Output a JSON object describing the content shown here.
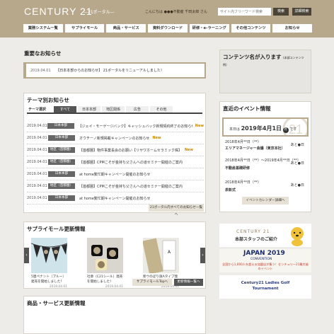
{
  "header": {
    "logo": "CENTURY 21",
    "logo_sub": "—21ポータル—",
    "greeting": "こんにちは ●●●不動産 千田太郎 さん",
    "search_placeholder": "サイト内フリーワード検索",
    "search_button": "検索",
    "advanced_button": "詳細検索"
  },
  "nav": [
    "業務システム一覧",
    "サプライモール",
    "商品・サービス",
    "資料ダウンロード",
    "研修・e-ラーニング",
    "その他コンテンツ",
    "お知らせ"
  ],
  "important": {
    "title": "重要なお知らせ",
    "date": "2019.04.01",
    "text": "【日本本部からのお知らせ】 21ポータルをリニューアルしました！"
  },
  "themed": {
    "title": "テーマ別お知らせ",
    "tab_label": "テーマ選択",
    "tabs": [
      "すべて",
      "日本本部",
      "地区関係",
      "広告",
      "その他"
    ],
    "rows": [
      {
        "date": "2019.04.01",
        "cat": "日本本部",
        "text": "【ジェイ・モーゲージバンク】キャッシュバック新規契約終了のお知らせ",
        "new": "New"
      },
      {
        "date": "2019.04.01",
        "cat": "日本本部",
        "text": "オウチーノ新規掲載キャンペーンのお知らせ",
        "new": "New"
      },
      {
        "date": "2019.04.01",
        "cat": "地区（首都圏）",
        "text": "【首都圏】物件事業長会のお願い【リサワホームセラミック株】",
        "new": "New"
      },
      {
        "date": "2019.04.01",
        "cat": "地区（首都圏）",
        "text": "【首都圏】CPMこそが金持ち父さんへの道セミナー開催のご案内",
        "new": ""
      },
      {
        "date": "2019.04.01",
        "cat": "日本本部",
        "text": "at home繁忙期キャンペーン開催のお知らせ",
        "new": ""
      },
      {
        "date": "2019.04.01",
        "cat": "地区（首都圏）",
        "text": "【首都圏】CPMこそが金持ち父さんへの道セミナー開催のご案内",
        "new": ""
      },
      {
        "date": "2019.04.01",
        "cat": "日本本部",
        "text": "at home繁忙期キャンペーン開催のお知らせ",
        "new": ""
      }
    ],
    "more": "21ポータル内すべてのお知らせ一覧へ"
  },
  "supply": {
    "title": "サプライモール更新情報",
    "items": [
      {
        "caption": "5連ペナント（ブルー）発売を開始しました！",
        "date": "2019.04.01"
      },
      {
        "caption": "社章（C21シール）発売を開始しました！",
        "date": "2019.04.01"
      },
      {
        "caption": "新ウのぼり旗Aタイプ発売を開始しました！",
        "date": "2019.04.01"
      }
    ],
    "btn_top": "サプライモールTopへ",
    "btn_list": "更新情報一覧へ"
  },
  "products": {
    "title": "商品・サービス更新情報"
  },
  "content_box": {
    "title": "コンテンツ名が入ります",
    "note": "(本部コンテンツ例)"
  },
  "events": {
    "title": "直近のイベント情報",
    "today_prefix": "本日は",
    "today_date": "2019年4月1日",
    "today_day": "月",
    "today_suffix": "です",
    "rows": [
      {
        "line1": "2018年4月**日（**）",
        "line2": "エリアマネージャー会議（東京本社）",
        "rest": "あと●日"
      },
      {
        "line1": "2018年4月**日（**）～2019年4月**日（**）",
        "line2": "不動産基礎研修",
        "rest": "あと●日"
      },
      {
        "line1": "2018年4月**日（**）",
        "line2": "表彰式",
        "rest": "あと●日"
      }
    ],
    "calendar_btn": "イベントカレンダー詳細へ"
  },
  "banners": {
    "b1_brand": "CENTURY 21",
    "b1_text": "本部スタッフのご紹介",
    "b2_title": "JAPAN 2019",
    "b2_sub": "CONVENTION",
    "b2_text": "全国から1,000人を超える加盟店が集う！センチュリー21最大級のイベント",
    "b3_title": "Century21 Ladies Golf Tournament"
  },
  "colors": {
    "brand": "#b7a88b",
    "dark": "#4a4438",
    "new": "#c98a00"
  }
}
